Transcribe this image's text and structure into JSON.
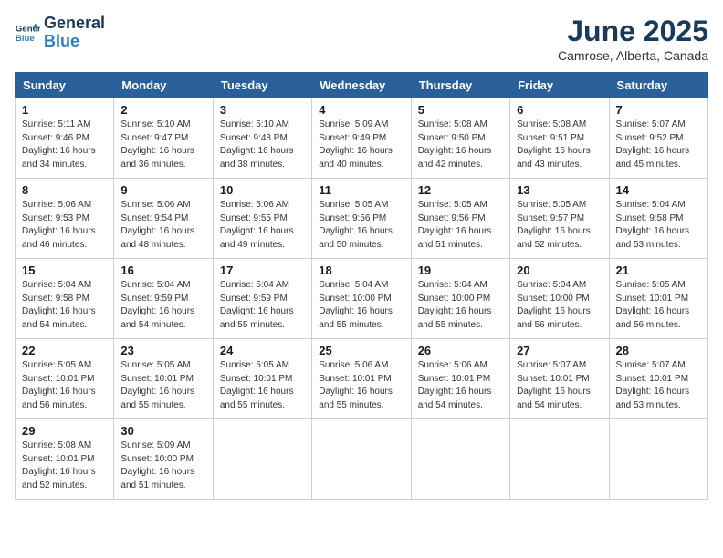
{
  "header": {
    "logo_line1": "General",
    "logo_line2": "Blue",
    "month_title": "June 2025",
    "location": "Camrose, Alberta, Canada"
  },
  "days_of_week": [
    "Sunday",
    "Monday",
    "Tuesday",
    "Wednesday",
    "Thursday",
    "Friday",
    "Saturday"
  ],
  "weeks": [
    [
      {
        "day": "1",
        "info": "Sunrise: 5:11 AM\nSunset: 9:46 PM\nDaylight: 16 hours\nand 34 minutes."
      },
      {
        "day": "2",
        "info": "Sunrise: 5:10 AM\nSunset: 9:47 PM\nDaylight: 16 hours\nand 36 minutes."
      },
      {
        "day": "3",
        "info": "Sunrise: 5:10 AM\nSunset: 9:48 PM\nDaylight: 16 hours\nand 38 minutes."
      },
      {
        "day": "4",
        "info": "Sunrise: 5:09 AM\nSunset: 9:49 PM\nDaylight: 16 hours\nand 40 minutes."
      },
      {
        "day": "5",
        "info": "Sunrise: 5:08 AM\nSunset: 9:50 PM\nDaylight: 16 hours\nand 42 minutes."
      },
      {
        "day": "6",
        "info": "Sunrise: 5:08 AM\nSunset: 9:51 PM\nDaylight: 16 hours\nand 43 minutes."
      },
      {
        "day": "7",
        "info": "Sunrise: 5:07 AM\nSunset: 9:52 PM\nDaylight: 16 hours\nand 45 minutes."
      }
    ],
    [
      {
        "day": "8",
        "info": "Sunrise: 5:06 AM\nSunset: 9:53 PM\nDaylight: 16 hours\nand 46 minutes."
      },
      {
        "day": "9",
        "info": "Sunrise: 5:06 AM\nSunset: 9:54 PM\nDaylight: 16 hours\nand 48 minutes."
      },
      {
        "day": "10",
        "info": "Sunrise: 5:06 AM\nSunset: 9:55 PM\nDaylight: 16 hours\nand 49 minutes."
      },
      {
        "day": "11",
        "info": "Sunrise: 5:05 AM\nSunset: 9:56 PM\nDaylight: 16 hours\nand 50 minutes."
      },
      {
        "day": "12",
        "info": "Sunrise: 5:05 AM\nSunset: 9:56 PM\nDaylight: 16 hours\nand 51 minutes."
      },
      {
        "day": "13",
        "info": "Sunrise: 5:05 AM\nSunset: 9:57 PM\nDaylight: 16 hours\nand 52 minutes."
      },
      {
        "day": "14",
        "info": "Sunrise: 5:04 AM\nSunset: 9:58 PM\nDaylight: 16 hours\nand 53 minutes."
      }
    ],
    [
      {
        "day": "15",
        "info": "Sunrise: 5:04 AM\nSunset: 9:58 PM\nDaylight: 16 hours\nand 54 minutes."
      },
      {
        "day": "16",
        "info": "Sunrise: 5:04 AM\nSunset: 9:59 PM\nDaylight: 16 hours\nand 54 minutes."
      },
      {
        "day": "17",
        "info": "Sunrise: 5:04 AM\nSunset: 9:59 PM\nDaylight: 16 hours\nand 55 minutes."
      },
      {
        "day": "18",
        "info": "Sunrise: 5:04 AM\nSunset: 10:00 PM\nDaylight: 16 hours\nand 55 minutes."
      },
      {
        "day": "19",
        "info": "Sunrise: 5:04 AM\nSunset: 10:00 PM\nDaylight: 16 hours\nand 55 minutes."
      },
      {
        "day": "20",
        "info": "Sunrise: 5:04 AM\nSunset: 10:00 PM\nDaylight: 16 hours\nand 56 minutes."
      },
      {
        "day": "21",
        "info": "Sunrise: 5:05 AM\nSunset: 10:01 PM\nDaylight: 16 hours\nand 56 minutes."
      }
    ],
    [
      {
        "day": "22",
        "info": "Sunrise: 5:05 AM\nSunset: 10:01 PM\nDaylight: 16 hours\nand 56 minutes."
      },
      {
        "day": "23",
        "info": "Sunrise: 5:05 AM\nSunset: 10:01 PM\nDaylight: 16 hours\nand 55 minutes."
      },
      {
        "day": "24",
        "info": "Sunrise: 5:05 AM\nSunset: 10:01 PM\nDaylight: 16 hours\nand 55 minutes."
      },
      {
        "day": "25",
        "info": "Sunrise: 5:06 AM\nSunset: 10:01 PM\nDaylight: 16 hours\nand 55 minutes."
      },
      {
        "day": "26",
        "info": "Sunrise: 5:06 AM\nSunset: 10:01 PM\nDaylight: 16 hours\nand 54 minutes."
      },
      {
        "day": "27",
        "info": "Sunrise: 5:07 AM\nSunset: 10:01 PM\nDaylight: 16 hours\nand 54 minutes."
      },
      {
        "day": "28",
        "info": "Sunrise: 5:07 AM\nSunset: 10:01 PM\nDaylight: 16 hours\nand 53 minutes."
      }
    ],
    [
      {
        "day": "29",
        "info": "Sunrise: 5:08 AM\nSunset: 10:01 PM\nDaylight: 16 hours\nand 52 minutes."
      },
      {
        "day": "30",
        "info": "Sunrise: 5:09 AM\nSunset: 10:00 PM\nDaylight: 16 hours\nand 51 minutes."
      },
      {
        "day": "",
        "info": ""
      },
      {
        "day": "",
        "info": ""
      },
      {
        "day": "",
        "info": ""
      },
      {
        "day": "",
        "info": ""
      },
      {
        "day": "",
        "info": ""
      }
    ]
  ]
}
